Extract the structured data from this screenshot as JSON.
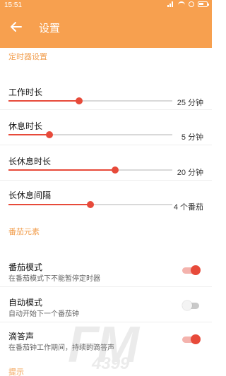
{
  "status_bar": {
    "time": "15:51"
  },
  "app_bar": {
    "title": "设置",
    "back_icon": "arrow-left-icon",
    "color": "#f7a04f"
  },
  "sections": {
    "timer": "定时器设置",
    "tomato": "番茄元素",
    "tips": "提示"
  },
  "sliders": [
    {
      "label": "工作时长",
      "value_text": "25 分钟",
      "level": 0.43
    },
    {
      "label": "休息时长",
      "value_text": "5 分钟",
      "level": 0.25
    },
    {
      "label": "长休息时长",
      "value_text": "20 分钟",
      "level": 0.65
    },
    {
      "label": "长休息间隔",
      "value_text": "4 个番茄",
      "level": 0.5
    }
  ],
  "toggles": [
    {
      "title": "番茄模式",
      "subtitle": "在番茄模式下不能暂停定时器",
      "on": true
    },
    {
      "title": "自动模式",
      "subtitle": "自动开始下一个番茄钟",
      "on": false
    },
    {
      "title": "滴答声",
      "subtitle": "在番茄钟工作期间，持续的滴答声",
      "on": true
    }
  ],
  "watermark": {
    "main": "FM",
    "sub": "4399"
  },
  "colors": {
    "accent": "#e74a3a",
    "header": "#f2a052"
  }
}
